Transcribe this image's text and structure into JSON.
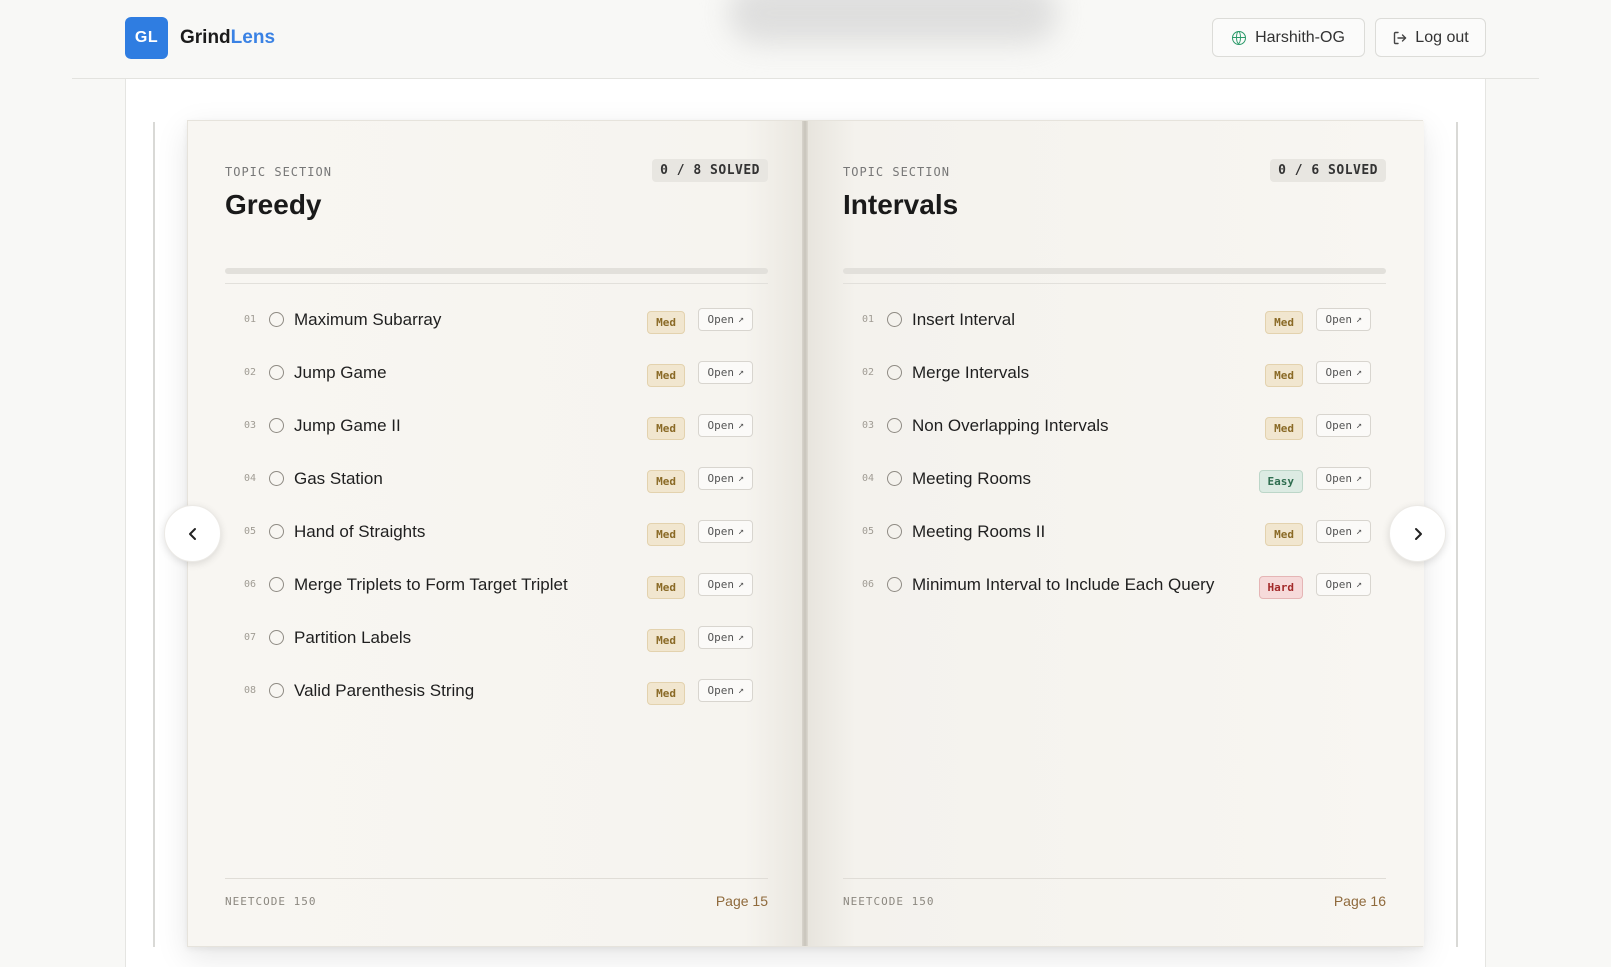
{
  "header": {
    "logo_text": "GL",
    "brand_main": "Grind",
    "brand_accent": "Lens",
    "user_label": "Harshith-OG",
    "logout_label": "Log out",
    "accent_color": "#2f7de1"
  },
  "book": {
    "left_page": {
      "kicker": "TOPIC SECTION",
      "title": "Greedy",
      "solved": "0 / 8 SOLVED",
      "progress": 0,
      "footer_label": "NEETCODE 150",
      "page_label": "Page 15",
      "problems": [
        {
          "num": "01",
          "name": "Maximum Subarray",
          "difficulty": "Med",
          "open": "Open"
        },
        {
          "num": "02",
          "name": "Jump Game",
          "difficulty": "Med",
          "open": "Open"
        },
        {
          "num": "03",
          "name": "Jump Game II",
          "difficulty": "Med",
          "open": "Open"
        },
        {
          "num": "04",
          "name": "Gas Station",
          "difficulty": "Med",
          "open": "Open"
        },
        {
          "num": "05",
          "name": "Hand of Straights",
          "difficulty": "Med",
          "open": "Open"
        },
        {
          "num": "06",
          "name": "Merge Triplets to Form Target Triplet",
          "difficulty": "Med",
          "open": "Open"
        },
        {
          "num": "07",
          "name": "Partition Labels",
          "difficulty": "Med",
          "open": "Open"
        },
        {
          "num": "08",
          "name": "Valid Parenthesis String",
          "difficulty": "Med",
          "open": "Open"
        }
      ]
    },
    "right_page": {
      "kicker": "TOPIC SECTION",
      "title": "Intervals",
      "solved": "0 / 6 SOLVED",
      "progress": 0,
      "footer_label": "NEETCODE 150",
      "page_label": "Page 16",
      "problems": [
        {
          "num": "01",
          "name": "Insert Interval",
          "difficulty": "Med",
          "open": "Open"
        },
        {
          "num": "02",
          "name": "Merge Intervals",
          "difficulty": "Med",
          "open": "Open"
        },
        {
          "num": "03",
          "name": "Non Overlapping Intervals",
          "difficulty": "Med",
          "open": "Open"
        },
        {
          "num": "04",
          "name": "Meeting Rooms",
          "difficulty": "Easy",
          "open": "Open"
        },
        {
          "num": "05",
          "name": "Meeting Rooms II",
          "difficulty": "Med",
          "open": "Open"
        },
        {
          "num": "06",
          "name": "Minimum Interval to Include Each Query",
          "difficulty": "Hard",
          "open": "Open"
        }
      ]
    }
  },
  "nav": {
    "prev_icon": "chevron-left-icon",
    "next_icon": "chevron-right-icon"
  }
}
